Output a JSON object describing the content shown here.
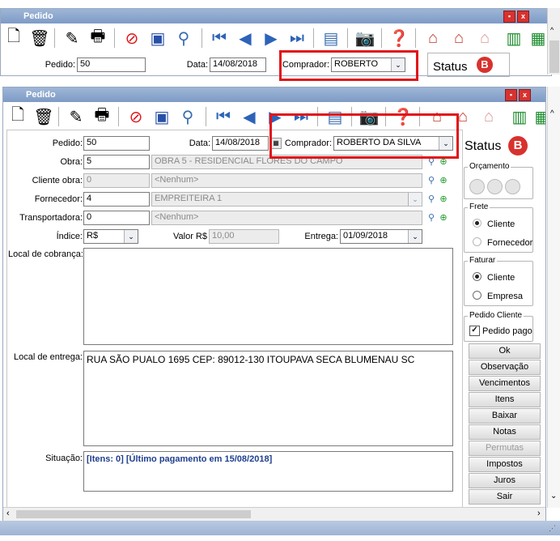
{
  "bg_window": {
    "title": "Pedido",
    "pedido_label": "Pedido:",
    "pedido_value": "50",
    "data_label": "Data:",
    "data_value": "14/08/2018",
    "comprador_label": "Comprador:",
    "comprador_value": "ROBERTO",
    "status_label": "Status"
  },
  "window": {
    "title": "Pedido",
    "minimize": "■",
    "close": "x"
  },
  "form": {
    "pedido_label": "Pedido:",
    "pedido_value": "50",
    "data_label": "Data:",
    "data_value": "14/08/2018",
    "comprador_label": "Comprador:",
    "comprador_value": "ROBERTO DA SILVA",
    "obra_label": "Obra:",
    "obra_code": "5",
    "obra_name": "OBRA 5 - RESIDENCIAL FLORES DO CAMPO",
    "cliente_obra_label": "Cliente obra:",
    "cliente_obra_code": "0",
    "cliente_obra_name": "<Nenhum>",
    "fornecedor_label": "Fornecedor:",
    "fornecedor_code": "4",
    "fornecedor_name": "EMPREITEIRA 1",
    "transportadora_label": "Transportadora:",
    "transportadora_code": "0",
    "transportadora_name": "<Nenhum>",
    "indice_label": "Índice:",
    "indice_value": "R$",
    "valor_label": "Valor R$",
    "valor_value": "10,00",
    "entrega_label": "Entrega:",
    "entrega_value": "01/09/2018",
    "cobranca_label": "Local de cobrança:",
    "cobranca_value": "",
    "entrega_local_label": "Local de entrega:",
    "entrega_local_value": "RUA SÃO PUALO 1695 CEP: 89012-130 ITOUPAVA SECA BLUMENAU SC",
    "situacao_label": "Situação:",
    "situacao_value": "[Itens: 0] [Último pagamento em 15/08/2018]"
  },
  "side": {
    "status_label": "Status",
    "orcamento_label": "Orçamento",
    "frete_label": "Frete",
    "frete_cliente": "Cliente",
    "frete_fornecedor": "Fornecedor",
    "faturar_label": "Faturar",
    "faturar_cliente": "Cliente",
    "faturar_empresa": "Empresa",
    "pedido_cliente_label": "Pedido Cliente",
    "pedido_pago": "Pedido pago",
    "buttons": [
      "Ok",
      "Observação",
      "Vencimentos",
      "Itens",
      "Baixar",
      "Notas",
      "Permutas",
      "Impostos",
      "Juros",
      "Sair"
    ]
  },
  "colors": {
    "titlebar": "#7d9bc6",
    "highlight": "#e0141a",
    "status_red": "#d8322e",
    "situacao_text": "#1f3f8f"
  },
  "icons": [
    "new-document-icon",
    "trash-icon",
    "tools-icon",
    "printer-icon",
    "cancel-icon",
    "save-icon",
    "search-icon",
    "first-record-icon",
    "previous-record-icon",
    "next-record-icon",
    "last-record-icon",
    "report-icon",
    "camera-icon",
    "help-icon",
    "house-icon",
    "barcode-icon"
  ]
}
